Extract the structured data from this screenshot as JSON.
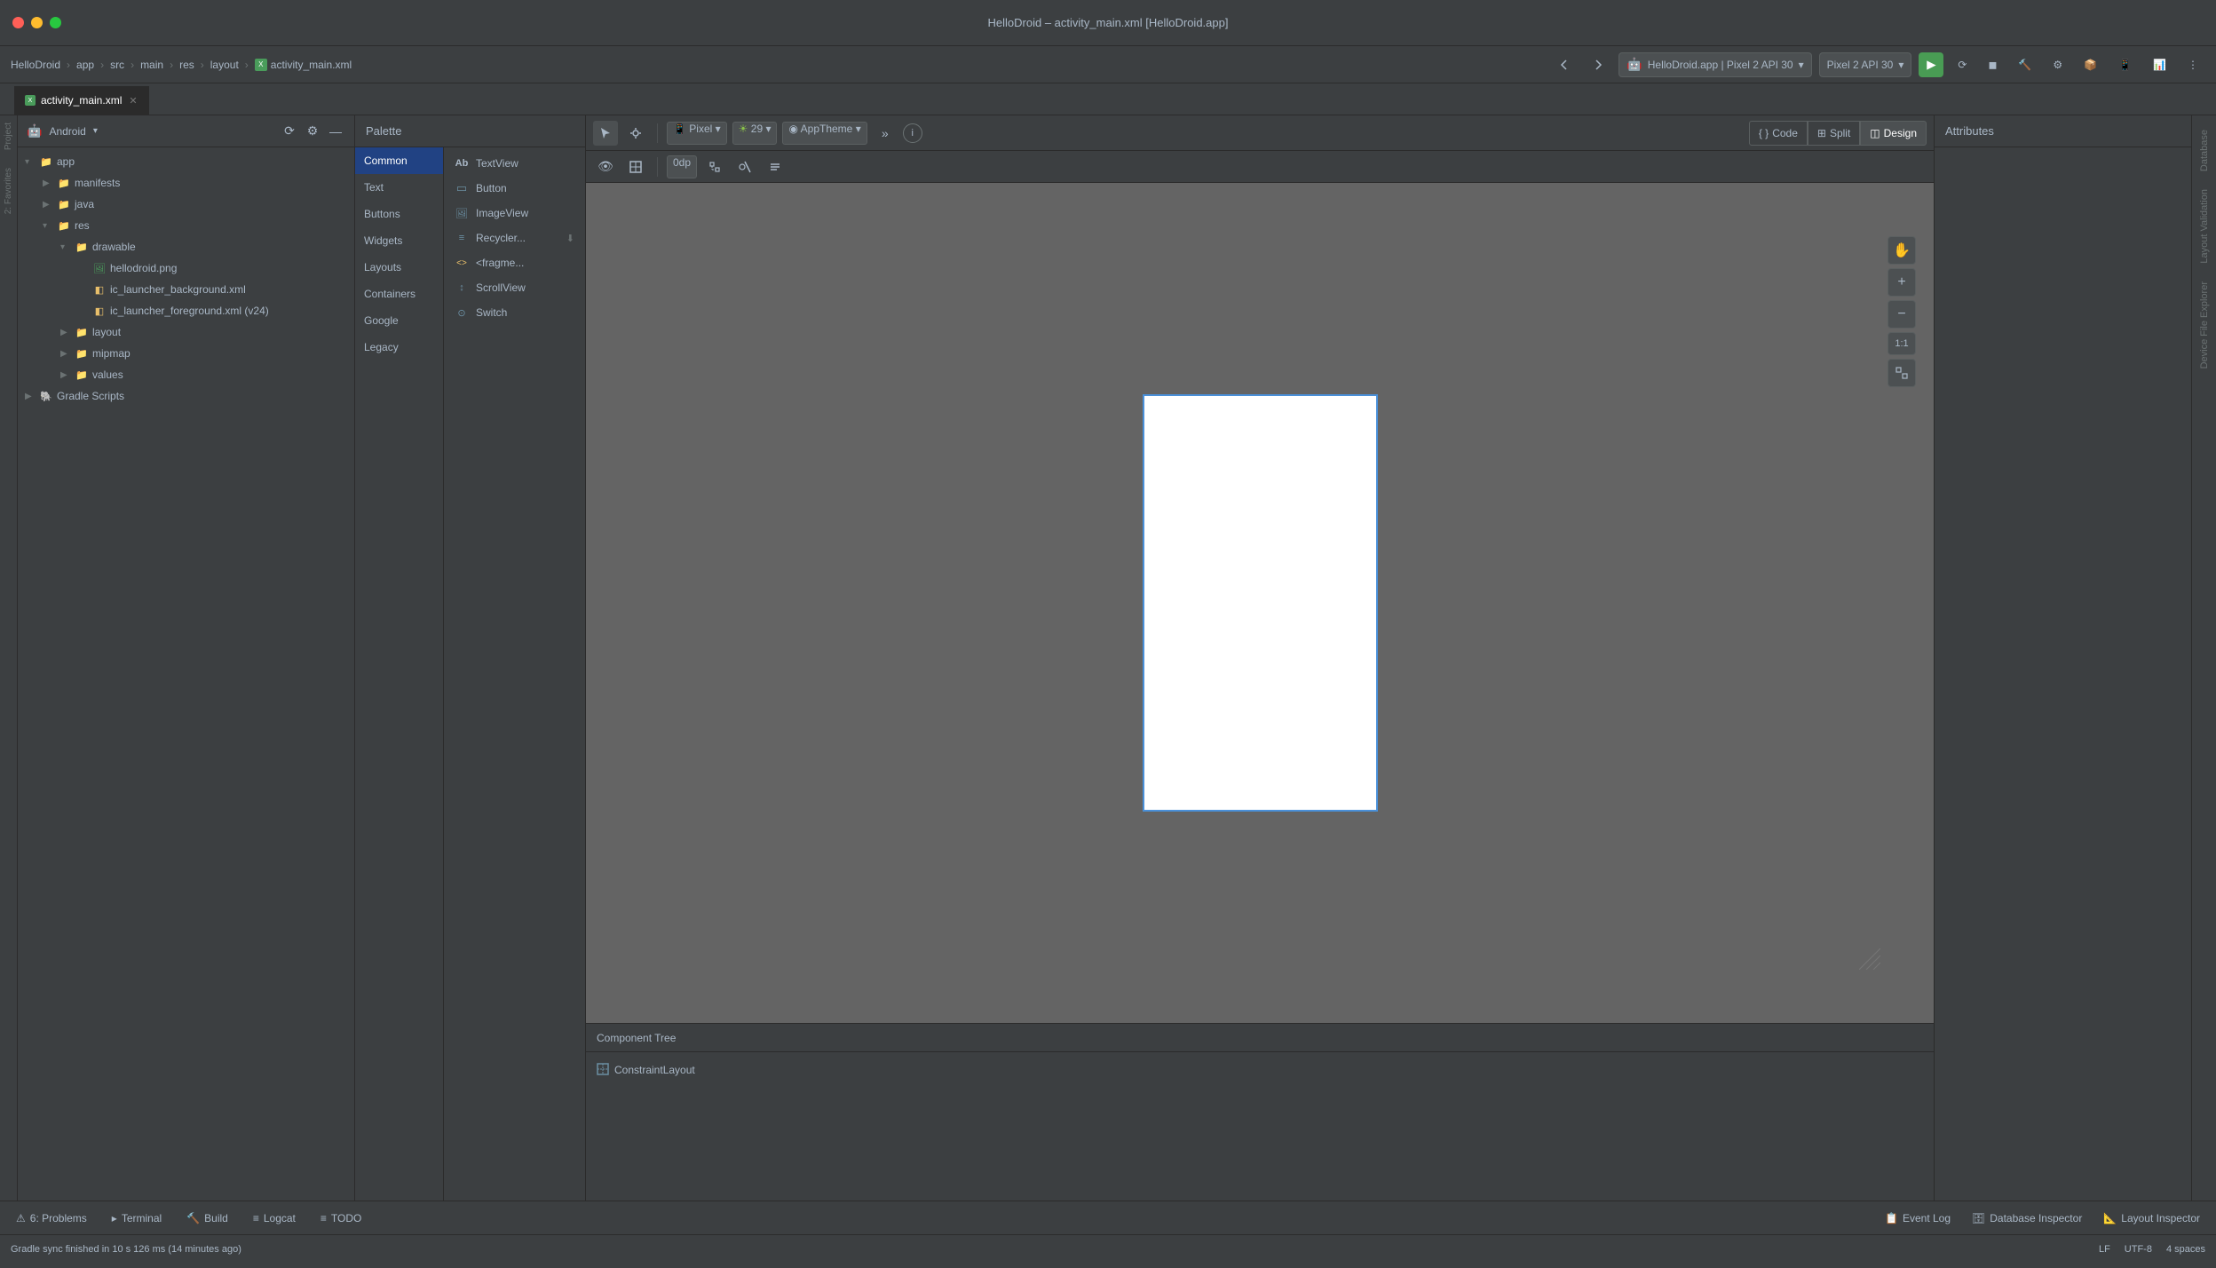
{
  "window": {
    "title": "HelloDroid – activity_main.xml [HelloDroid.app]"
  },
  "titlebar": {
    "title": "HelloDroid – activity_main.xml [HelloDroid.app]"
  },
  "breadcrumb": {
    "items": [
      "HelloDroid",
      "app",
      "src",
      "main",
      "res",
      "layout"
    ],
    "file": "activity_main.xml"
  },
  "toolbar": {
    "back_label": "◀",
    "forward_label": "▶",
    "device_label": "HelloDroid.app | Pixel 2 API 30",
    "pixel_label": "Pixel 2 API 30",
    "run_icon": "▶",
    "sync_icon": "⟳",
    "gradle_icon": "🔨"
  },
  "project_panel": {
    "title": "Android",
    "root": {
      "label": "app",
      "children": [
        {
          "label": "manifests",
          "type": "folder"
        },
        {
          "label": "java",
          "type": "folder"
        },
        {
          "label": "res",
          "type": "folder",
          "expanded": true,
          "children": [
            {
              "label": "drawable",
              "type": "folder",
              "expanded": true,
              "children": [
                {
                  "label": "hellodroid.png",
                  "type": "png"
                },
                {
                  "label": "ic_launcher_background.xml",
                  "type": "xml"
                },
                {
                  "label": "ic_launcher_foreground.xml (v24)",
                  "type": "xml"
                }
              ]
            },
            {
              "label": "layout",
              "type": "folder"
            },
            {
              "label": "mipmap",
              "type": "folder"
            },
            {
              "label": "values",
              "type": "folder"
            }
          ]
        },
        {
          "label": "Gradle Scripts",
          "type": "folder"
        }
      ]
    }
  },
  "editor": {
    "tab": "activity_main.xml"
  },
  "palette": {
    "title": "Palette",
    "categories": [
      "Common",
      "Text",
      "Buttons",
      "Widgets",
      "Layouts",
      "Containers",
      "Google",
      "Legacy"
    ],
    "selected_category": "Common",
    "items": [
      {
        "label": "TextView",
        "icon": "Ab",
        "icon_color": "#a9b7c6"
      },
      {
        "label": "Button",
        "icon": "▭",
        "icon_color": "#6b8fa3"
      },
      {
        "label": "ImageView",
        "icon": "🖼",
        "icon_color": "#6b8fa3"
      },
      {
        "label": "Recycler...",
        "icon": "≡",
        "icon_color": "#6b8fa3",
        "download": true
      },
      {
        "label": "<fragme...",
        "icon": "<>",
        "icon_color": "#e8bf6a"
      },
      {
        "label": "ScrollView",
        "icon": "↕",
        "icon_color": "#6b8fa3"
      },
      {
        "label": "Switch",
        "icon": "⊙",
        "icon_color": "#6b8fa3"
      }
    ]
  },
  "design_toolbar": {
    "pixel_label": "Pixel",
    "api_label": "29",
    "theme_label": "AppTheme",
    "margin_label": "0dp",
    "view_modes": [
      "Code",
      "Split",
      "Design"
    ]
  },
  "design_canvas": {
    "zoom_label": "1:1"
  },
  "component_tree": {
    "title": "Component Tree",
    "items": [
      {
        "label": "ConstraintLayout",
        "icon": "⊟"
      }
    ]
  },
  "attributes_panel": {
    "title": "Attributes"
  },
  "bottom_tabs": [
    {
      "label": "6: Problems",
      "icon": "⚠"
    },
    {
      "label": "Terminal",
      "icon": "▸"
    },
    {
      "label": "Build",
      "icon": "🔨"
    },
    {
      "label": "Logcat",
      "icon": "📋"
    },
    {
      "label": "TODO",
      "icon": "≡"
    }
  ],
  "bottom_right_tabs": [
    {
      "label": "Event Log",
      "icon": "📋"
    },
    {
      "label": "Database Inspector",
      "icon": "🗄"
    },
    {
      "label": "Layout Inspector",
      "icon": "📐"
    }
  ],
  "status_bar": {
    "message": "Gradle sync finished in 10 s 126 ms (14 minutes ago)",
    "encoding": "LF   UTF-8",
    "indent": "4 spaces"
  },
  "left_vtabs": [
    "Project",
    "Favorites",
    "2:"
  ],
  "right_vtabs": [
    "Database",
    "Layout Validation",
    "Device File Explorer"
  ],
  "colors": {
    "bg_dark": "#3c3f41",
    "bg_darker": "#2b2b2b",
    "border": "#2b2b2b",
    "accent": "#4a90d9",
    "selected": "#214283",
    "hover": "#4c5052",
    "text_primary": "#a9b7c6",
    "text_muted": "#6b7273",
    "run_green": "#499c54"
  }
}
